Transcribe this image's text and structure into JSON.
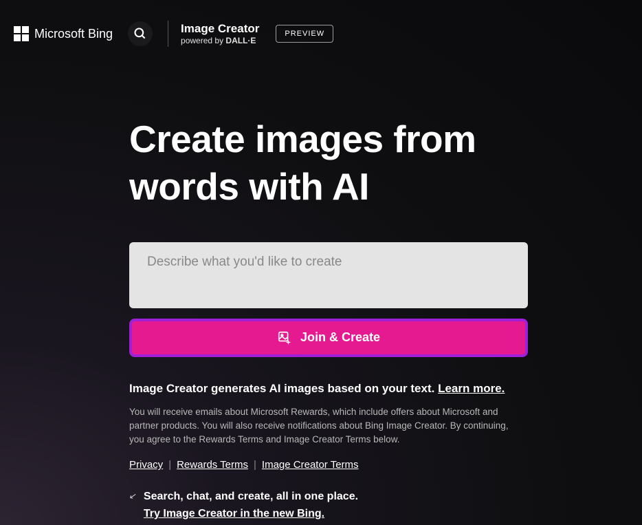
{
  "header": {
    "brand": "Microsoft Bing",
    "product_title": "Image Creator",
    "powered_prefix": "powered by ",
    "powered_brand": "DALL·E",
    "preview_badge": "PREVIEW"
  },
  "hero": {
    "title": "Create images from words with AI",
    "prompt_placeholder": "Describe what you'd like to create",
    "cta_label": "Join & Create"
  },
  "tagline": {
    "text": "Image Creator generates AI images based on your text. ",
    "link": "Learn more."
  },
  "disclaimer": "You will receive emails about Microsoft Rewards, which include offers about Microsoft and partner products. You will also receive notifications about Bing Image Creator. By continuing, you agree to the Rewards Terms and Image Creator Terms below.",
  "legal": {
    "privacy": "Privacy",
    "rewards": "Rewards Terms",
    "creator": "Image Creator Terms"
  },
  "promo": {
    "line1": "Search, chat, and create, all in one place.",
    "link": "Try Image Creator in the new Bing."
  }
}
